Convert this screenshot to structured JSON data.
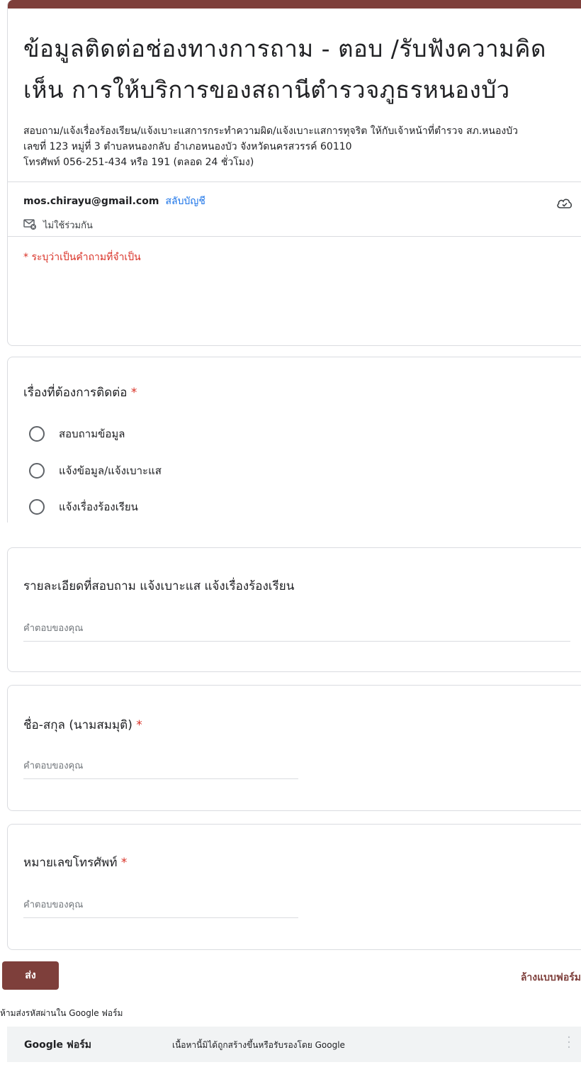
{
  "form": {
    "title": "ข้อมูลติดต่อช่องทางการถาม - ตอบ /รับฟังความคิดเห็น การให้บริการของสถานีตำรวจภูธรหนองบัว",
    "description": "สอบถาม/แจ้งเรื่องร้องเรียน/แจ้งเบาะแสการกระทำความผิด/แจ้งเบาะแสการทุจริต ให้กับเจ้าหน้าที่ตำรวจ สภ.หนองบัว\nเลขที่ 123 หมู่ที่ 3 ตำบลหนองกลับ อำเภอหนองบัว จังหวัดนครสวรรค์ 60110\nโทรศัพท์ 056-251-434  หรือ 191 (ตลอด 24 ชั่วโมง)",
    "accent_color": "#7e3f3b"
  },
  "account": {
    "email": "mos.chirayu@gmail.com",
    "switch_label": "สลับบัญชี",
    "not_shared": "ไม่ใช้ร่วมกัน"
  },
  "required_note": "* ระบุว่าเป็นคำถามที่จำเป็น",
  "questions": [
    {
      "title": "เรื่องที่ต้องการติดต่อ",
      "required": "*",
      "options": [
        "สอบถามข้อมูล",
        "แจ้งข้อมูล/แจ้งเบาะแส",
        "แจ้งเรื่องร้องเรียน"
      ]
    },
    {
      "title": "รายละเอียดที่สอบถาม แจ้งเบาะแส แจ้งเรื่องร้องเรียน",
      "placeholder": "คำตอบของคุณ"
    },
    {
      "title": "ชื่อ-สกุล (นามสมมุติ)",
      "required": "*",
      "placeholder": "คำตอบของคุณ"
    },
    {
      "title": "หมายเลขโทรศัพท์",
      "required": "*",
      "placeholder": "คำตอบของคุณ"
    }
  ],
  "actions": {
    "submit_label": "ส่ง",
    "clear_label": "ล้างแบบฟอร์ม"
  },
  "password_warning": "ห้ามส่งรหัสผ่านใน Google ฟอร์ม",
  "footer": {
    "brand": "Google ฟอร์ม",
    "disclaimer": "เนื้อหานี้มิได้ถูกสร้างขึ้นหรือรับรองโดย Google"
  }
}
